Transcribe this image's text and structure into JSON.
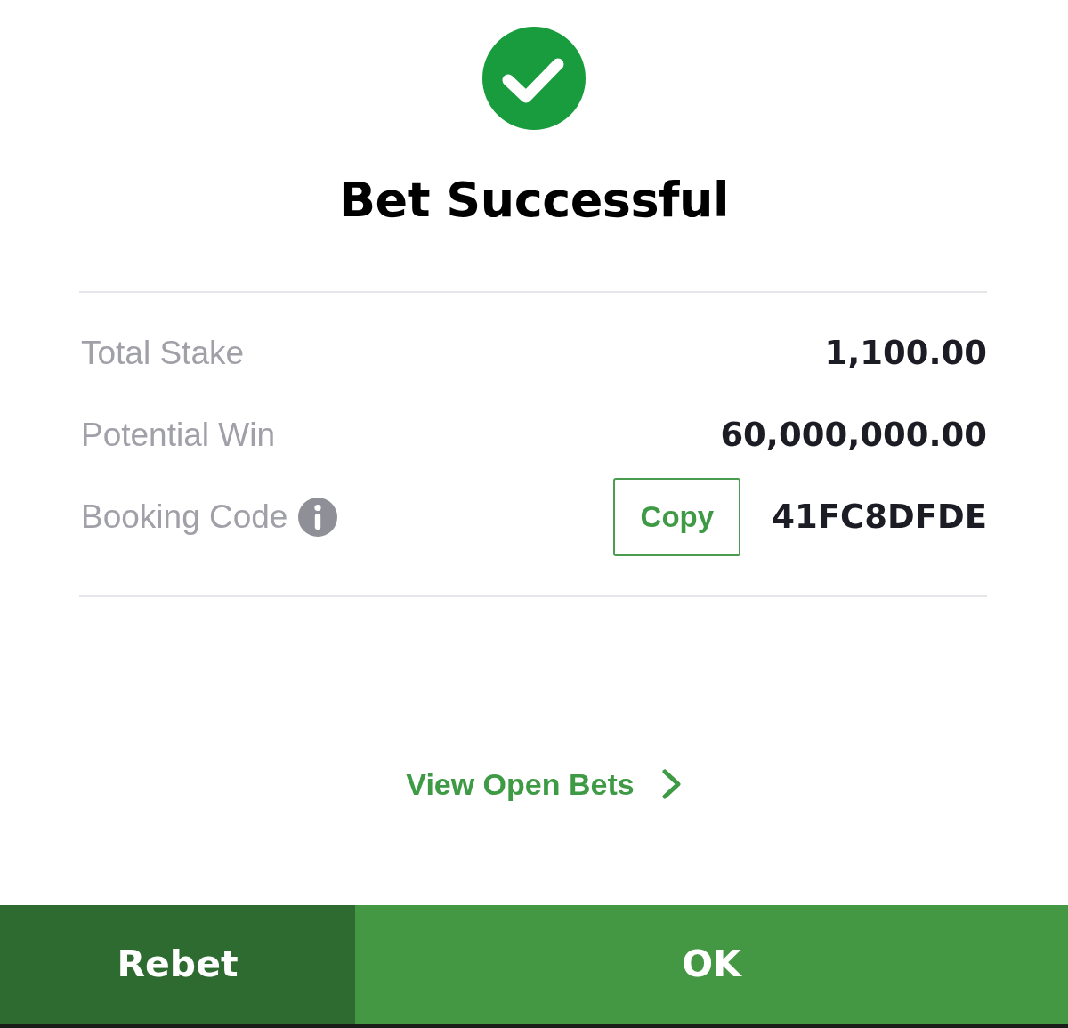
{
  "title": "Bet Successful",
  "summary": [
    {
      "label": "Total Stake",
      "value": "1,100.00"
    },
    {
      "label": "Potential Win",
      "value": "60,000,000.00"
    },
    {
      "label": "Booking Code",
      "info": true,
      "copy_button": "Copy",
      "value": "41FC8DFDE"
    }
  ],
  "link": {
    "label": "View Open Bets"
  },
  "actions": [
    {
      "label": "Rebet",
      "kind": "secondary"
    },
    {
      "label": "OK",
      "kind": "primary"
    }
  ]
}
